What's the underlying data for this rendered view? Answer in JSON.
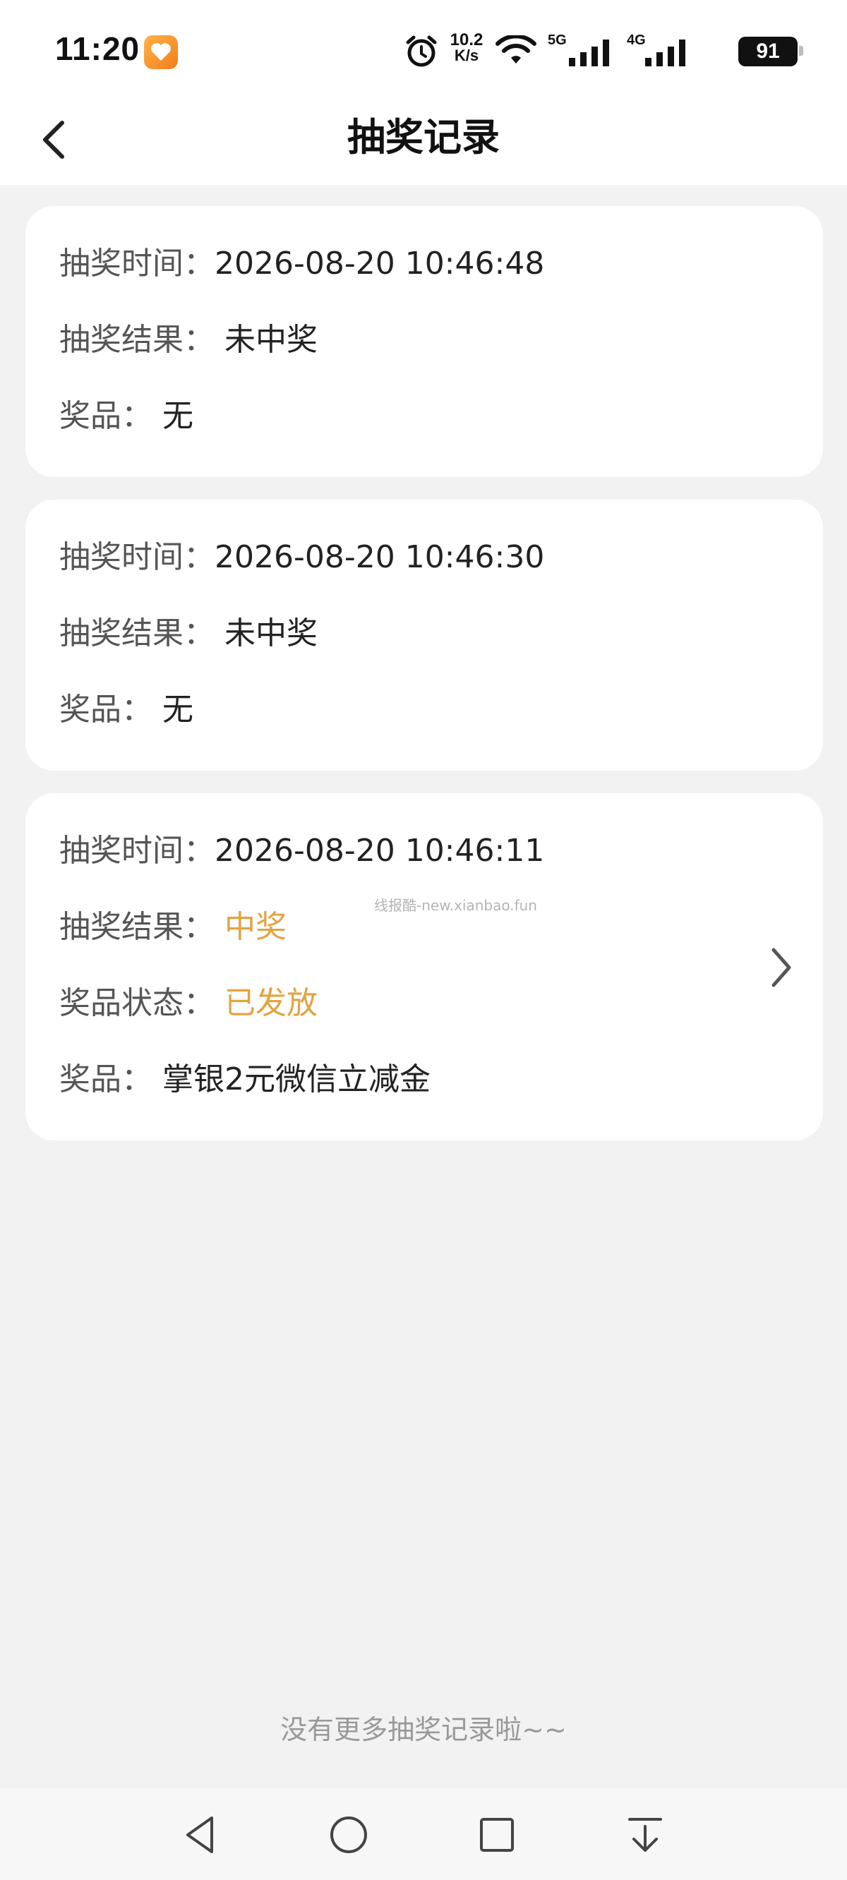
{
  "status_bar": {
    "time": "11:20",
    "net_speed_value": "10.2",
    "net_speed_unit": "K/s",
    "sim1_label": "5G",
    "sim2_label": "4G",
    "battery": "91"
  },
  "header": {
    "title": "抽奖记录"
  },
  "records": [
    {
      "time_label": "抽奖时间：",
      "time_value": "2026-08-20 10:46:48",
      "result_label": "抽奖结果：",
      "result_value": "未中奖",
      "prize_label": "奖品：",
      "prize_value": "无"
    },
    {
      "time_label": "抽奖时间：",
      "time_value": "2026-08-20 10:46:30",
      "result_label": "抽奖结果：",
      "result_value": "未中奖",
      "prize_label": "奖品：",
      "prize_value": "无"
    },
    {
      "time_label": "抽奖时间：",
      "time_value": "2026-08-20 10:46:11",
      "result_label": "抽奖结果：",
      "result_value": "中奖",
      "status_label": "奖品状态：",
      "status_value": "已发放",
      "prize_label": "奖品：",
      "prize_value": "掌银2元微信立减金"
    }
  ],
  "watermark": "线报酷-new.xianbao.fun",
  "footer": {
    "end_text": "没有更多抽奖记录啦~~"
  },
  "colors": {
    "highlight": "#e3a33f",
    "background": "#f2f2f2",
    "card": "#ffffff"
  }
}
